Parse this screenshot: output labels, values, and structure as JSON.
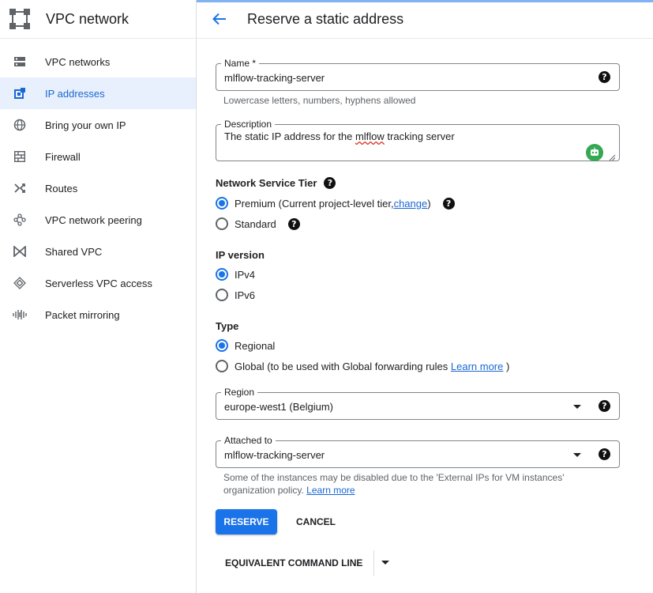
{
  "sidebar": {
    "title": "VPC network",
    "items": [
      {
        "label": "VPC networks",
        "icon": "vpc-networks-icon"
      },
      {
        "label": "IP addresses",
        "icon": "ip-addresses-icon",
        "active": true
      },
      {
        "label": "Bring your own IP",
        "icon": "globe-icon"
      },
      {
        "label": "Firewall",
        "icon": "firewall-icon"
      },
      {
        "label": "Routes",
        "icon": "routes-icon"
      },
      {
        "label": "VPC network peering",
        "icon": "peering-icon"
      },
      {
        "label": "Shared VPC",
        "icon": "shared-vpc-icon"
      },
      {
        "label": "Serverless VPC access",
        "icon": "serverless-icon"
      },
      {
        "label": "Packet mirroring",
        "icon": "packet-mirroring-icon"
      }
    ]
  },
  "header": {
    "title": "Reserve a static address"
  },
  "form": {
    "name": {
      "label": "Name *",
      "value": "mlflow-tracking-server",
      "hint": "Lowercase letters, numbers, hyphens allowed"
    },
    "description": {
      "label": "Description",
      "value_prefix": "The static IP address for the ",
      "value_misspelled": "mlflow",
      "value_suffix": " tracking server"
    },
    "tier": {
      "label": "Network Service Tier",
      "premium_prefix": "Premium (Current project-level tier, ",
      "premium_link": "change",
      "premium_suffix": ")",
      "standard": "Standard",
      "selected": "premium"
    },
    "ip_version": {
      "label": "IP version",
      "ipv4": "IPv4",
      "ipv6": "IPv6",
      "selected": "ipv4"
    },
    "type": {
      "label": "Type",
      "regional": "Regional",
      "global_prefix": "Global (to be used with Global forwarding rules ",
      "global_link": "Learn more",
      "global_suffix": ")",
      "selected": "regional"
    },
    "region": {
      "label": "Region",
      "value": "europe-west1 (Belgium)"
    },
    "attached_to": {
      "label": "Attached to",
      "value": "mlflow-tracking-server",
      "hint_line1": "Some of the instances may be disabled due to the 'External IPs for VM instances'",
      "hint_line2": "organization policy. ",
      "hint_link": "Learn more"
    }
  },
  "buttons": {
    "reserve": "RESERVE",
    "cancel": "CANCEL",
    "command_line": "EQUIVALENT COMMAND LINE"
  },
  "colors": {
    "accent": "#1a73e8",
    "active_bg": "#e8f0fe",
    "grammar_badge": "#34a853"
  }
}
